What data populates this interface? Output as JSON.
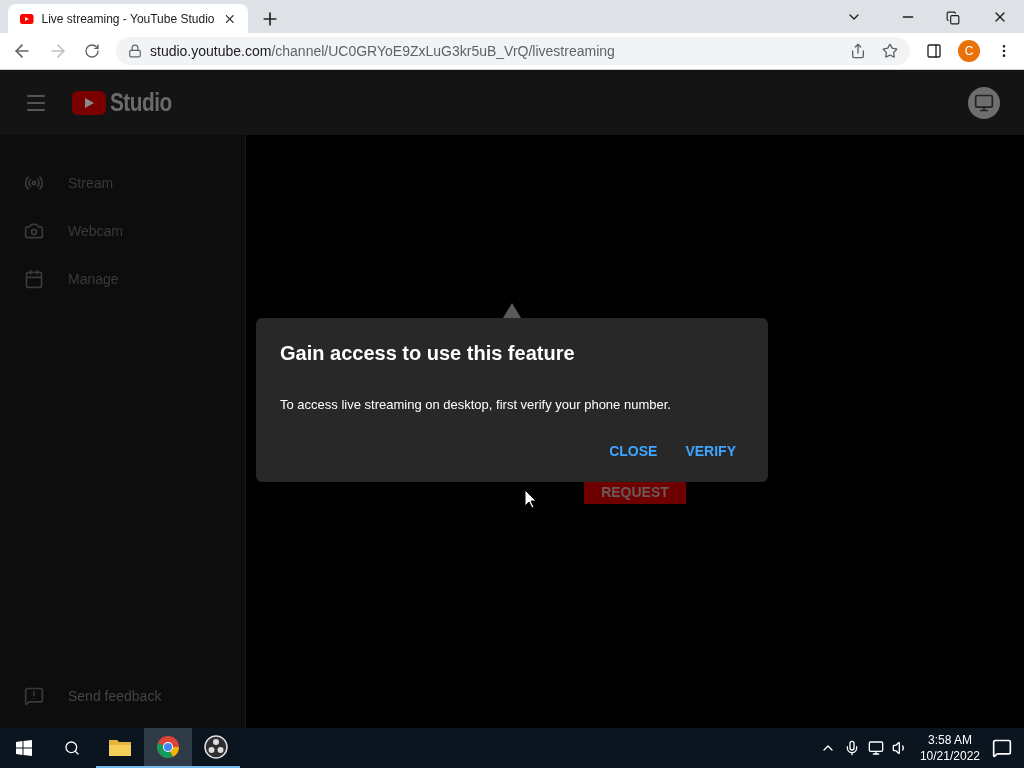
{
  "browser": {
    "tab_title": "Live streaming - YouTube Studio",
    "url_host": "studio.youtube.com",
    "url_path": "/channel/UC0GRYoE9ZxLuG3kr5uB_VrQ/livestreaming",
    "profile_initial": "C"
  },
  "app": {
    "logo_text": "Studio"
  },
  "sidebar": {
    "items": [
      {
        "label": "Stream",
        "kind": "stream"
      },
      {
        "label": "Webcam",
        "kind": "webcam"
      },
      {
        "label": "Manage",
        "kind": "calendar"
      }
    ],
    "feedback": "Send feedback"
  },
  "background": {
    "request_button": "REQUEST"
  },
  "dialog": {
    "title": "Gain access to use this feature",
    "message": "To access live streaming on desktop, first verify your phone number.",
    "buttons": [
      "CLOSE",
      "VERIFY"
    ]
  },
  "taskbar": {
    "apps": [
      {
        "kind": "folder",
        "selected": false
      },
      {
        "kind": "chrome",
        "selected": true
      },
      {
        "kind": "obs",
        "selected": false
      }
    ],
    "time": "3:58 AM",
    "date": "10/21/2022"
  }
}
